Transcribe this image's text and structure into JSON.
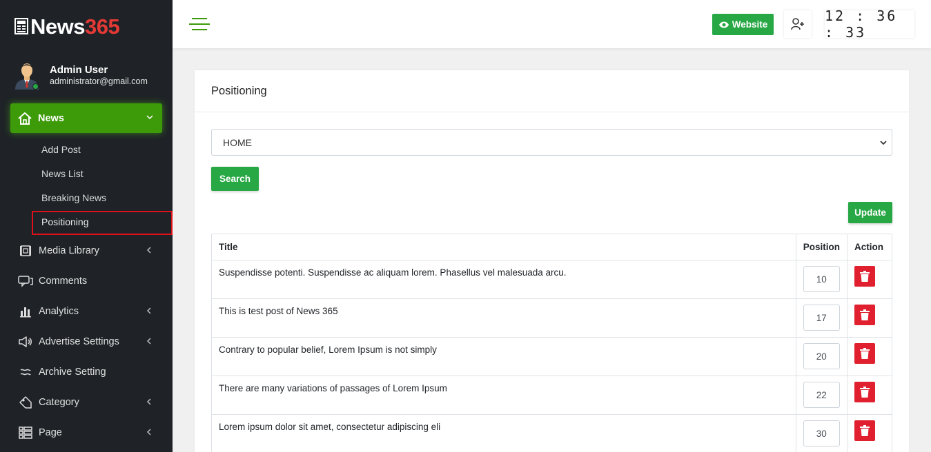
{
  "brand": {
    "name_part1": "News",
    "name_part2": "365"
  },
  "user": {
    "name": "Admin User",
    "email": "administrator@gmail.com",
    "status": "online"
  },
  "sidebar": {
    "active_section": {
      "label": "News",
      "icon": "home-icon"
    },
    "submenu": [
      {
        "label": "Add Post"
      },
      {
        "label": "News List"
      },
      {
        "label": "Breaking News"
      },
      {
        "label": "Positioning",
        "selected": true
      }
    ],
    "items": [
      {
        "label": "Media Library",
        "icon": "media-library-icon",
        "has_children": true
      },
      {
        "label": "Comments",
        "icon": "comments-icon",
        "has_children": false
      },
      {
        "label": "Analytics",
        "icon": "bar-chart-icon",
        "has_children": true
      },
      {
        "label": "Advertise Settings",
        "icon": "megaphone-icon",
        "has_children": true
      },
      {
        "label": "Archive Setting",
        "icon": "waves-icon",
        "has_children": false
      },
      {
        "label": "Category",
        "icon": "tag-icon",
        "has_children": true
      },
      {
        "label": "Page",
        "icon": "list-icon",
        "has_children": true
      }
    ]
  },
  "topbar": {
    "website_label": "Website",
    "clock": "12 : 36 : 33"
  },
  "main": {
    "title": "Positioning",
    "select_value": "HOME",
    "search_label": "Search",
    "update_label": "Update",
    "table": {
      "headers": {
        "title": "Title",
        "position": "Position",
        "action": "Action"
      },
      "rows": [
        {
          "title": "Suspendisse potenti. Suspendisse ac aliquam lorem. Phasellus vel malesuada arcu.",
          "position": "10"
        },
        {
          "title": "This is test post of News 365",
          "position": "17"
        },
        {
          "title": "Contrary to popular belief, Lorem Ipsum is not simply",
          "position": "20"
        },
        {
          "title": "There are many variations of passages of Lorem Ipsum",
          "position": "22"
        },
        {
          "title": "Lorem ipsum dolor sit amet, consectetur adipiscing eli",
          "position": "30"
        }
      ]
    }
  },
  "colors": {
    "sidebar_bg": "#1f2327",
    "accent_green": "#28a745",
    "active_menu_green": "#3d9b0a",
    "delete_red": "#e0202e",
    "brand_red": "#e53935"
  }
}
